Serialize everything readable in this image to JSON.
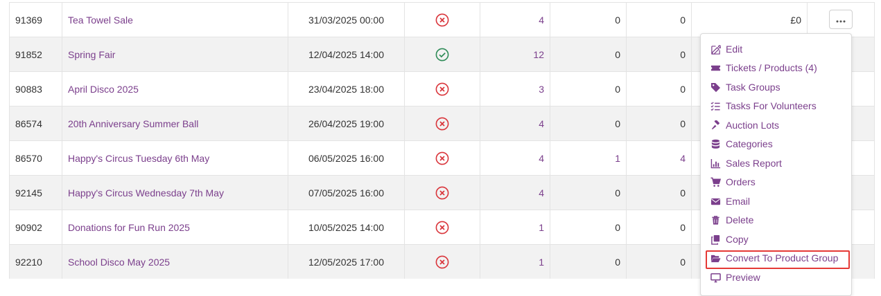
{
  "rows": [
    {
      "id": "91369",
      "name": "Tea Towel Sale",
      "date": "31/03/2025 00:00",
      "status": "inactive",
      "n1": "4",
      "n2": "0",
      "n3": "0",
      "total": "£0"
    },
    {
      "id": "91852",
      "name": "Spring Fair",
      "date": "12/04/2025 14:00",
      "status": "active",
      "n1": "12",
      "n2": "0",
      "n3": "0",
      "total": ""
    },
    {
      "id": "90883",
      "name": "April Disco 2025",
      "date": "23/04/2025 18:00",
      "status": "inactive",
      "n1": "3",
      "n2": "0",
      "n3": "0",
      "total": ""
    },
    {
      "id": "86574",
      "name": "20th Anniversary Summer Ball",
      "date": "26/04/2025 19:00",
      "status": "inactive",
      "n1": "4",
      "n2": "0",
      "n3": "0",
      "total": ""
    },
    {
      "id": "86570",
      "name": "Happy's Circus Tuesday 6th May",
      "date": "06/05/2025 16:00",
      "status": "inactive",
      "n1": "4",
      "n2": "1",
      "n3": "4",
      "total": ""
    },
    {
      "id": "92145",
      "name": "Happy's Circus Wednesday 7th May",
      "date": "07/05/2025 16:00",
      "status": "inactive",
      "n1": "4",
      "n2": "0",
      "n3": "0",
      "total": ""
    },
    {
      "id": "90902",
      "name": "Donations for Fun Run 2025",
      "date": "10/05/2025 14:00",
      "status": "inactive",
      "n1": "1",
      "n2": "0",
      "n3": "0",
      "total": ""
    },
    {
      "id": "92210",
      "name": "School Disco May 2025",
      "date": "12/05/2025 17:00",
      "status": "inactive",
      "n1": "1",
      "n2": "0",
      "n3": "0",
      "total": ""
    }
  ],
  "action_button": {
    "label": "···"
  },
  "menu": {
    "items": [
      {
        "label": "Edit",
        "icon": "edit-icon"
      },
      {
        "label": "Tickets / Products (4)",
        "icon": "ticket-icon"
      },
      {
        "label": "Task Groups",
        "icon": "tag-icon"
      },
      {
        "label": "Tasks For Volunteers",
        "icon": "tasks-icon"
      },
      {
        "label": "Auction Lots",
        "icon": "gavel-icon"
      },
      {
        "label": "Categories",
        "icon": "database-icon"
      },
      {
        "label": "Sales Report",
        "icon": "chart-icon"
      },
      {
        "label": "Orders",
        "icon": "cart-icon"
      },
      {
        "label": "Email",
        "icon": "envelope-icon"
      },
      {
        "label": "Delete",
        "icon": "trash-icon"
      },
      {
        "label": "Copy",
        "icon": "copy-icon"
      },
      {
        "label": "Convert To Product Group",
        "icon": "folder-open-icon"
      },
      {
        "label": "Preview",
        "icon": "monitor-icon"
      }
    ],
    "highlighted_item": "Convert To Product Group"
  },
  "colors": {
    "link": "#7b3f8c",
    "active": "#2e8b57",
    "inactive": "#d9343a",
    "highlight": "#e53935"
  }
}
